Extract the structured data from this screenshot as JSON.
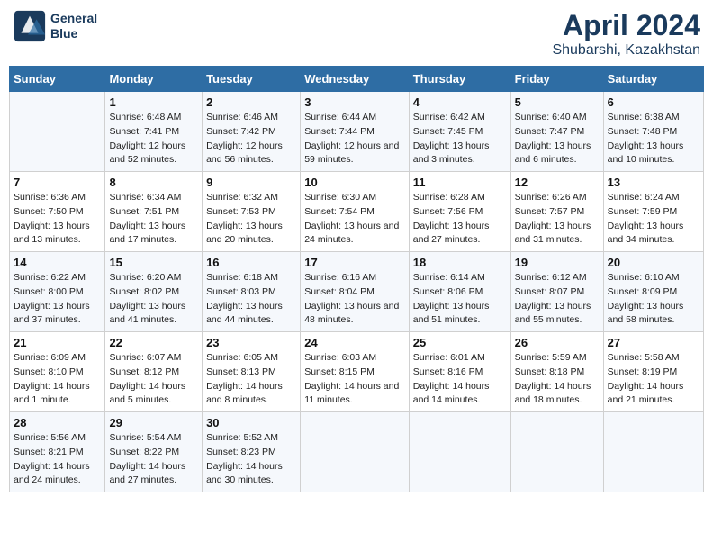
{
  "header": {
    "logo_line1": "General",
    "logo_line2": "Blue",
    "title": "April 2024",
    "subtitle": "Shubarshi, Kazakhstan"
  },
  "days_of_week": [
    "Sunday",
    "Monday",
    "Tuesday",
    "Wednesday",
    "Thursday",
    "Friday",
    "Saturday"
  ],
  "weeks": [
    [
      {
        "day": "",
        "sunrise": "",
        "sunset": "",
        "daylight": ""
      },
      {
        "day": "1",
        "sunrise": "Sunrise: 6:48 AM",
        "sunset": "Sunset: 7:41 PM",
        "daylight": "Daylight: 12 hours and 52 minutes."
      },
      {
        "day": "2",
        "sunrise": "Sunrise: 6:46 AM",
        "sunset": "Sunset: 7:42 PM",
        "daylight": "Daylight: 12 hours and 56 minutes."
      },
      {
        "day": "3",
        "sunrise": "Sunrise: 6:44 AM",
        "sunset": "Sunset: 7:44 PM",
        "daylight": "Daylight: 12 hours and 59 minutes."
      },
      {
        "day": "4",
        "sunrise": "Sunrise: 6:42 AM",
        "sunset": "Sunset: 7:45 PM",
        "daylight": "Daylight: 13 hours and 3 minutes."
      },
      {
        "day": "5",
        "sunrise": "Sunrise: 6:40 AM",
        "sunset": "Sunset: 7:47 PM",
        "daylight": "Daylight: 13 hours and 6 minutes."
      },
      {
        "day": "6",
        "sunrise": "Sunrise: 6:38 AM",
        "sunset": "Sunset: 7:48 PM",
        "daylight": "Daylight: 13 hours and 10 minutes."
      }
    ],
    [
      {
        "day": "7",
        "sunrise": "Sunrise: 6:36 AM",
        "sunset": "Sunset: 7:50 PM",
        "daylight": "Daylight: 13 hours and 13 minutes."
      },
      {
        "day": "8",
        "sunrise": "Sunrise: 6:34 AM",
        "sunset": "Sunset: 7:51 PM",
        "daylight": "Daylight: 13 hours and 17 minutes."
      },
      {
        "day": "9",
        "sunrise": "Sunrise: 6:32 AM",
        "sunset": "Sunset: 7:53 PM",
        "daylight": "Daylight: 13 hours and 20 minutes."
      },
      {
        "day": "10",
        "sunrise": "Sunrise: 6:30 AM",
        "sunset": "Sunset: 7:54 PM",
        "daylight": "Daylight: 13 hours and 24 minutes."
      },
      {
        "day": "11",
        "sunrise": "Sunrise: 6:28 AM",
        "sunset": "Sunset: 7:56 PM",
        "daylight": "Daylight: 13 hours and 27 minutes."
      },
      {
        "day": "12",
        "sunrise": "Sunrise: 6:26 AM",
        "sunset": "Sunset: 7:57 PM",
        "daylight": "Daylight: 13 hours and 31 minutes."
      },
      {
        "day": "13",
        "sunrise": "Sunrise: 6:24 AM",
        "sunset": "Sunset: 7:59 PM",
        "daylight": "Daylight: 13 hours and 34 minutes."
      }
    ],
    [
      {
        "day": "14",
        "sunrise": "Sunrise: 6:22 AM",
        "sunset": "Sunset: 8:00 PM",
        "daylight": "Daylight: 13 hours and 37 minutes."
      },
      {
        "day": "15",
        "sunrise": "Sunrise: 6:20 AM",
        "sunset": "Sunset: 8:02 PM",
        "daylight": "Daylight: 13 hours and 41 minutes."
      },
      {
        "day": "16",
        "sunrise": "Sunrise: 6:18 AM",
        "sunset": "Sunset: 8:03 PM",
        "daylight": "Daylight: 13 hours and 44 minutes."
      },
      {
        "day": "17",
        "sunrise": "Sunrise: 6:16 AM",
        "sunset": "Sunset: 8:04 PM",
        "daylight": "Daylight: 13 hours and 48 minutes."
      },
      {
        "day": "18",
        "sunrise": "Sunrise: 6:14 AM",
        "sunset": "Sunset: 8:06 PM",
        "daylight": "Daylight: 13 hours and 51 minutes."
      },
      {
        "day": "19",
        "sunrise": "Sunrise: 6:12 AM",
        "sunset": "Sunset: 8:07 PM",
        "daylight": "Daylight: 13 hours and 55 minutes."
      },
      {
        "day": "20",
        "sunrise": "Sunrise: 6:10 AM",
        "sunset": "Sunset: 8:09 PM",
        "daylight": "Daylight: 13 hours and 58 minutes."
      }
    ],
    [
      {
        "day": "21",
        "sunrise": "Sunrise: 6:09 AM",
        "sunset": "Sunset: 8:10 PM",
        "daylight": "Daylight: 14 hours and 1 minute."
      },
      {
        "day": "22",
        "sunrise": "Sunrise: 6:07 AM",
        "sunset": "Sunset: 8:12 PM",
        "daylight": "Daylight: 14 hours and 5 minutes."
      },
      {
        "day": "23",
        "sunrise": "Sunrise: 6:05 AM",
        "sunset": "Sunset: 8:13 PM",
        "daylight": "Daylight: 14 hours and 8 minutes."
      },
      {
        "day": "24",
        "sunrise": "Sunrise: 6:03 AM",
        "sunset": "Sunset: 8:15 PM",
        "daylight": "Daylight: 14 hours and 11 minutes."
      },
      {
        "day": "25",
        "sunrise": "Sunrise: 6:01 AM",
        "sunset": "Sunset: 8:16 PM",
        "daylight": "Daylight: 14 hours and 14 minutes."
      },
      {
        "day": "26",
        "sunrise": "Sunrise: 5:59 AM",
        "sunset": "Sunset: 8:18 PM",
        "daylight": "Daylight: 14 hours and 18 minutes."
      },
      {
        "day": "27",
        "sunrise": "Sunrise: 5:58 AM",
        "sunset": "Sunset: 8:19 PM",
        "daylight": "Daylight: 14 hours and 21 minutes."
      }
    ],
    [
      {
        "day": "28",
        "sunrise": "Sunrise: 5:56 AM",
        "sunset": "Sunset: 8:21 PM",
        "daylight": "Daylight: 14 hours and 24 minutes."
      },
      {
        "day": "29",
        "sunrise": "Sunrise: 5:54 AM",
        "sunset": "Sunset: 8:22 PM",
        "daylight": "Daylight: 14 hours and 27 minutes."
      },
      {
        "day": "30",
        "sunrise": "Sunrise: 5:52 AM",
        "sunset": "Sunset: 8:23 PM",
        "daylight": "Daylight: 14 hours and 30 minutes."
      },
      {
        "day": "",
        "sunrise": "",
        "sunset": "",
        "daylight": ""
      },
      {
        "day": "",
        "sunrise": "",
        "sunset": "",
        "daylight": ""
      },
      {
        "day": "",
        "sunrise": "",
        "sunset": "",
        "daylight": ""
      },
      {
        "day": "",
        "sunrise": "",
        "sunset": "",
        "daylight": ""
      }
    ]
  ]
}
